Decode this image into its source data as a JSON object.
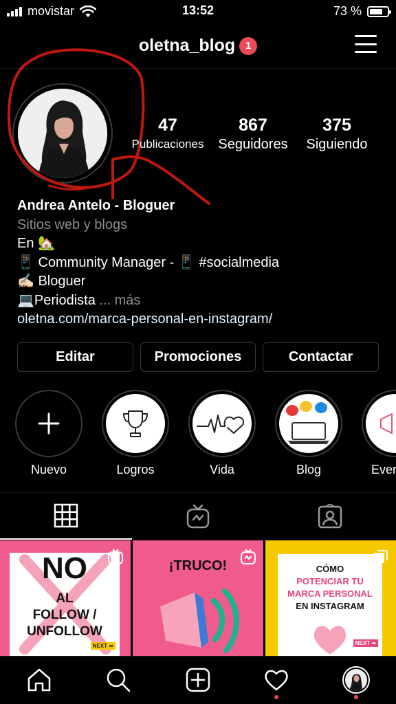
{
  "status_bar": {
    "carrier": "movistar",
    "time": "13:52",
    "battery": "73 %",
    "battery_level": 0.73
  },
  "header": {
    "username": "oletna_blog",
    "notification_count": "1"
  },
  "stats": [
    {
      "value": "47",
      "label": "Publicaciones"
    },
    {
      "value": "867",
      "label": "Seguidores"
    },
    {
      "value": "375",
      "label": "Siguiendo"
    }
  ],
  "bio": {
    "name": "Andrea Antelo - Bloguer",
    "category": "Sitios web y blogs",
    "line1": "En 🏡",
    "line2": "📱 Community Manager - 📱 #socialmedia",
    "line3": "✍🏻 Bloguer",
    "line4": "💻Periodista",
    "more": "... más",
    "link": "oletna.com/marca-personal-en-instagram/"
  },
  "buttons": {
    "edit": "Editar",
    "promotions": "Promociones",
    "contact": "Contactar"
  },
  "highlights": [
    {
      "label": "Nuevo",
      "icon": "plus-icon"
    },
    {
      "label": "Logros",
      "icon": "trophy-icon"
    },
    {
      "label": "Vida",
      "icon": "heartbeat-icon"
    },
    {
      "label": "Blog",
      "icon": "laptop-icon"
    },
    {
      "label": "Even",
      "icon": "megaphone-icon"
    }
  ],
  "tabs": [
    "grid-icon",
    "igtv-icon",
    "tagged-icon"
  ],
  "posts": [
    {
      "line1": "NO",
      "line2": "AL",
      "line3": "FOLLOW /",
      "line4": "UNFOLLOW",
      "tag": "NEXT ➡",
      "bg": "#ef5b8c"
    },
    {
      "line1": "¡TRUCO!",
      "bg": "#ef5b8c"
    },
    {
      "line1": "CÓMO",
      "line2": "POTENCIAR TU",
      "line3": "MARCA PERSONAL",
      "line4": "EN INSTAGRAM",
      "tag": "NEXT ➡",
      "bg": "#f5c800"
    }
  ],
  "colors": {
    "background": "#000000",
    "badge": "#ed4956",
    "link": "#e0f1ff",
    "muted": "#8e8e8e",
    "annotation": "#c0180f"
  },
  "bottom_nav": [
    "home-icon",
    "search-icon",
    "add-post-icon",
    "heart-icon",
    "profile-avatar"
  ]
}
